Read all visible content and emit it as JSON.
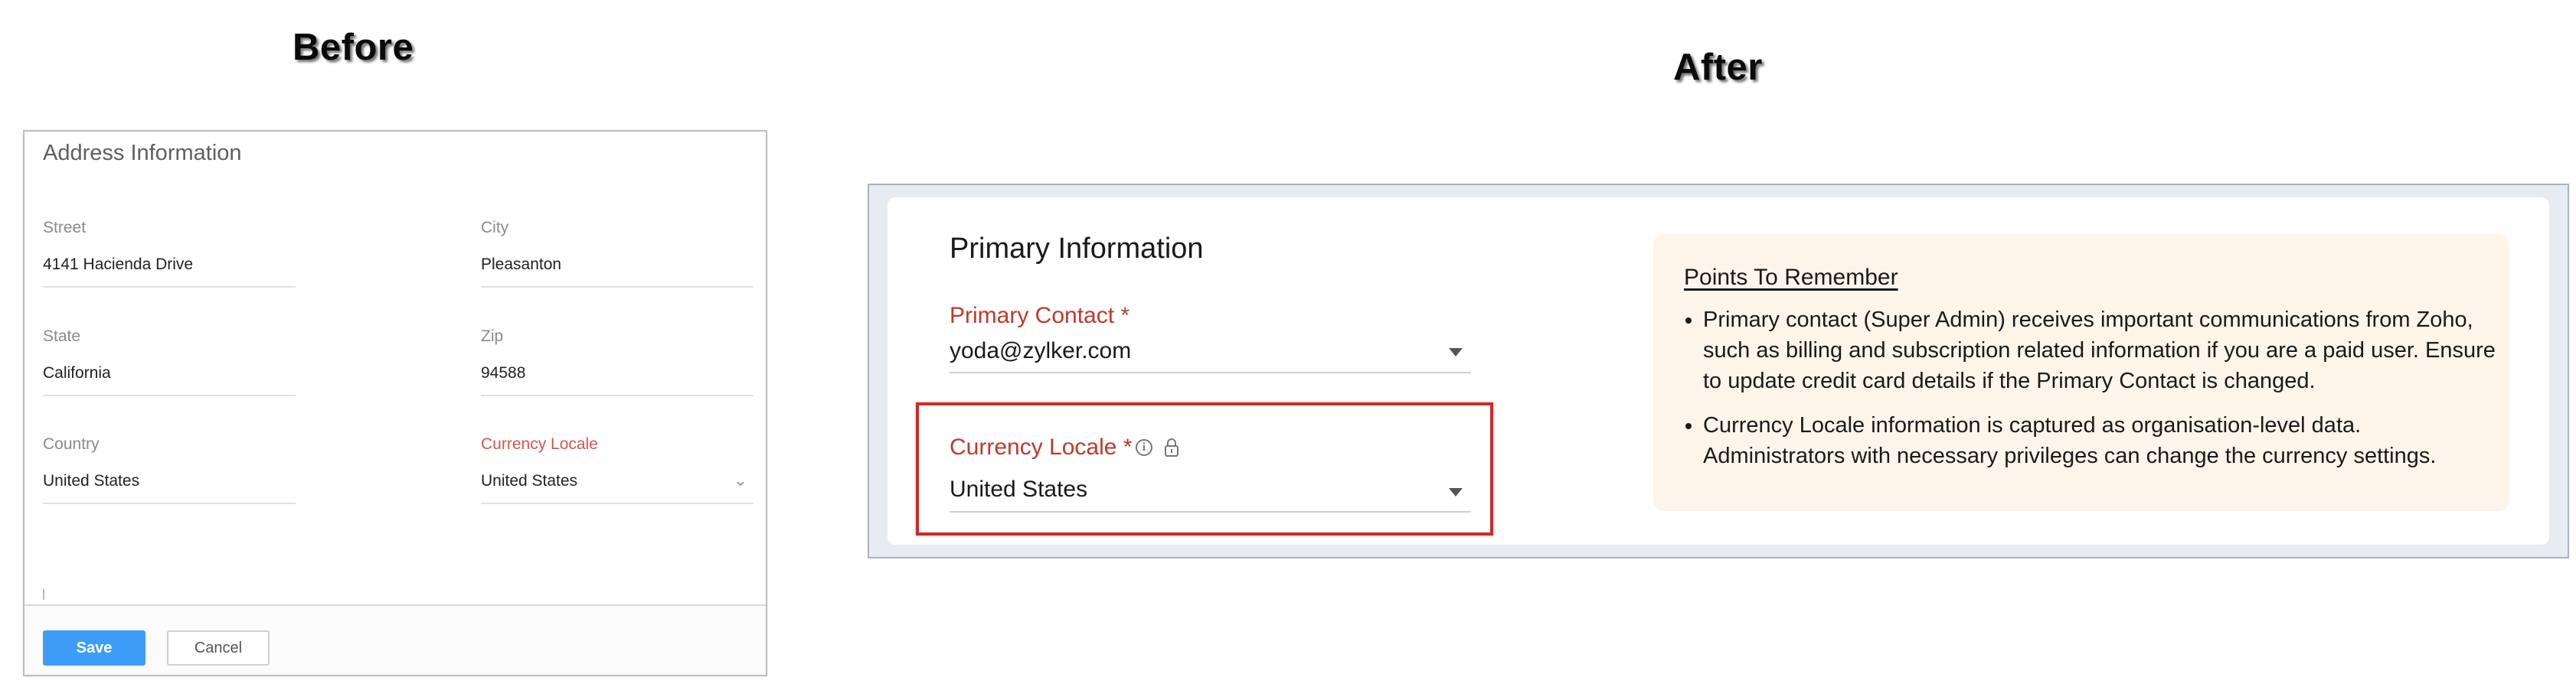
{
  "captions": {
    "before": "Before",
    "after": "After"
  },
  "before": {
    "title": "Address Information",
    "fields": {
      "street": {
        "label": "Street",
        "value": "4141 Hacienda Drive"
      },
      "city": {
        "label": "City",
        "value": "Pleasanton"
      },
      "state": {
        "label": "State",
        "value": "California"
      },
      "zip": {
        "label": "Zip",
        "value": "94588"
      },
      "country": {
        "label": "Country",
        "value": "United States"
      },
      "currency_locale": {
        "label": "Currency Locale",
        "value": "United States"
      }
    },
    "buttons": {
      "save": "Save",
      "cancel": "Cancel"
    },
    "colors": {
      "save_bg": "#3d9cf5",
      "required_label": "#d9534f"
    }
  },
  "after": {
    "title": "Primary Information",
    "primary_contact": {
      "label": "Primary Contact *",
      "value": "yoda@zylker.com"
    },
    "currency_locale": {
      "label": "Currency Locale *",
      "value": "United States"
    },
    "icons": [
      "info-icon",
      "lock-icon",
      "caret-down-icon"
    ],
    "points_to_remember": {
      "title": "Points To Remember",
      "items": [
        "Primary contact (Super Admin) receives important communications from Zoho, such as billing and subscription related information if you are a paid user. Ensure to update credit card details if the Primary Contact is changed.",
        "Currency Locale information is captured as organisation-level data. Administrators with necessary privileges can change the currency settings."
      ]
    },
    "colors": {
      "label_red": "#c0392b",
      "highlight_border": "#cc2a2a",
      "notes_bg": "#fdf5ea"
    }
  }
}
